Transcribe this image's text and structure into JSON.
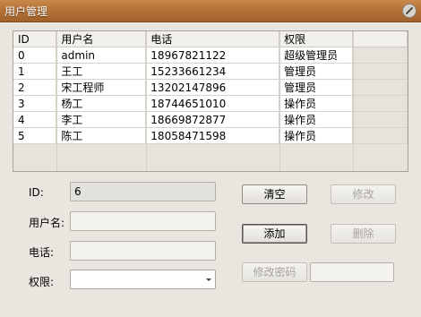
{
  "window": {
    "title": "用户管理"
  },
  "table": {
    "columns": [
      "ID",
      "用户名",
      "电话",
      "权限"
    ],
    "rows": [
      [
        "0",
        "admin",
        "18967821122",
        "超级管理员"
      ],
      [
        "1",
        "王工",
        "15233661234",
        "管理员"
      ],
      [
        "2",
        "宋工程师",
        "13202147896",
        "管理员"
      ],
      [
        "3",
        "杨工",
        "18744651010",
        "操作员"
      ],
      [
        "4",
        "李工",
        "18669872877",
        "操作员"
      ],
      [
        "5",
        "陈工",
        "18058471598",
        "操作员"
      ]
    ]
  },
  "form": {
    "id_label": "ID:",
    "id_value": "6",
    "username_label": "用户名:",
    "username_value": "",
    "phone_label": "电话:",
    "phone_value": "",
    "permission_label": "权限:",
    "permission_value": ""
  },
  "buttons": {
    "clear": "清空",
    "modify": "修改",
    "add": "添加",
    "delete": "删除",
    "change_password": "修改密码"
  },
  "password_field": {
    "value": ""
  }
}
